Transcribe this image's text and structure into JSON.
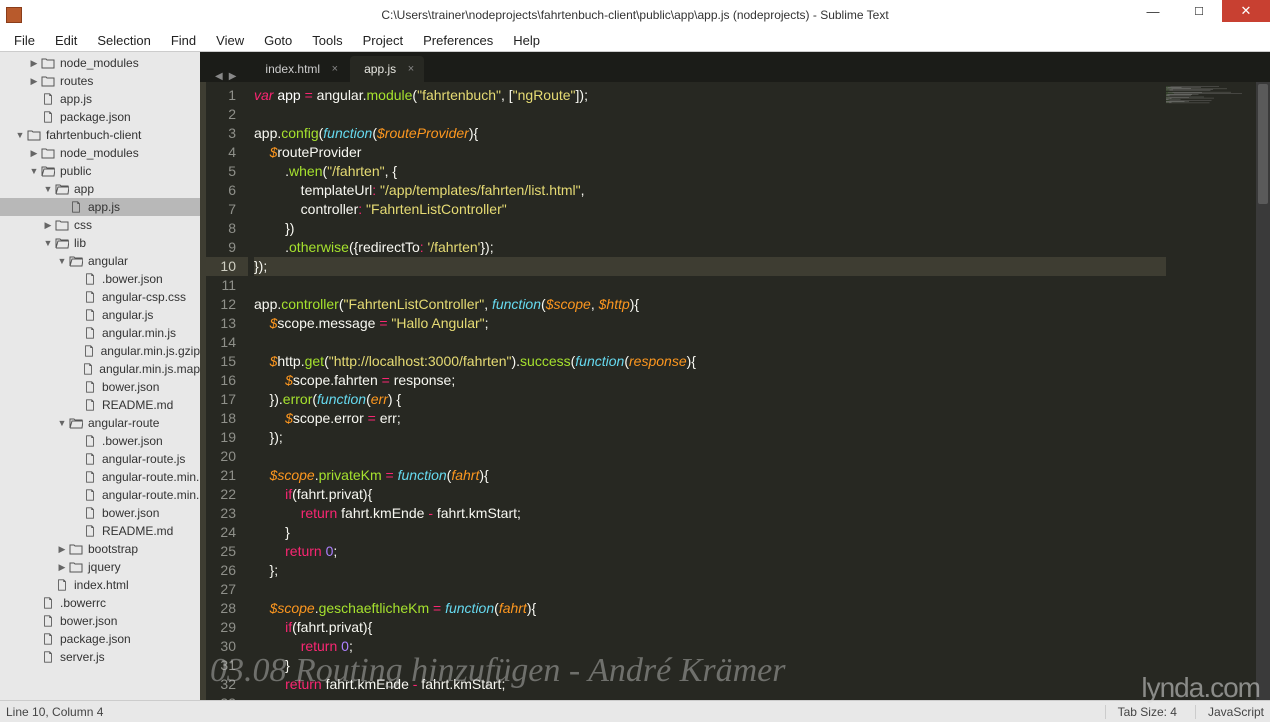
{
  "window": {
    "title": "C:\\Users\\trainer\\nodeprojects\\fahrtenbuch-client\\public\\app\\app.js (nodeprojects) - Sublime Text"
  },
  "menu": [
    "File",
    "Edit",
    "Selection",
    "Find",
    "View",
    "Goto",
    "Tools",
    "Project",
    "Preferences",
    "Help"
  ],
  "sidebar": [
    {
      "d": 2,
      "t": "folder",
      "a": "r",
      "label": "node_modules"
    },
    {
      "d": 2,
      "t": "folder",
      "a": "r",
      "label": "routes"
    },
    {
      "d": 2,
      "t": "file",
      "label": "app.js"
    },
    {
      "d": 2,
      "t": "file",
      "label": "package.json"
    },
    {
      "d": 1,
      "t": "folder",
      "a": "d",
      "label": "fahrtenbuch-client"
    },
    {
      "d": 2,
      "t": "folder",
      "a": "r",
      "label": "node_modules"
    },
    {
      "d": 2,
      "t": "folder-open",
      "a": "d",
      "label": "public"
    },
    {
      "d": 3,
      "t": "folder-open",
      "a": "d",
      "label": "app"
    },
    {
      "d": 4,
      "t": "file",
      "label": "app.js",
      "selected": true
    },
    {
      "d": 3,
      "t": "folder",
      "a": "r",
      "label": "css"
    },
    {
      "d": 3,
      "t": "folder-open",
      "a": "d",
      "label": "lib"
    },
    {
      "d": 4,
      "t": "folder-open",
      "a": "d",
      "label": "angular"
    },
    {
      "d": 5,
      "t": "file",
      "label": ".bower.json"
    },
    {
      "d": 5,
      "t": "file",
      "label": "angular-csp.css"
    },
    {
      "d": 5,
      "t": "file",
      "label": "angular.js"
    },
    {
      "d": 5,
      "t": "file",
      "label": "angular.min.js"
    },
    {
      "d": 5,
      "t": "file",
      "label": "angular.min.js.gzip"
    },
    {
      "d": 5,
      "t": "file",
      "label": "angular.min.js.map"
    },
    {
      "d": 5,
      "t": "file",
      "label": "bower.json"
    },
    {
      "d": 5,
      "t": "file",
      "label": "README.md"
    },
    {
      "d": 4,
      "t": "folder-open",
      "a": "d",
      "label": "angular-route"
    },
    {
      "d": 5,
      "t": "file",
      "label": ".bower.json"
    },
    {
      "d": 5,
      "t": "file",
      "label": "angular-route.js"
    },
    {
      "d": 5,
      "t": "file",
      "label": "angular-route.min."
    },
    {
      "d": 5,
      "t": "file",
      "label": "angular-route.min."
    },
    {
      "d": 5,
      "t": "file",
      "label": "bower.json"
    },
    {
      "d": 5,
      "t": "file",
      "label": "README.md"
    },
    {
      "d": 4,
      "t": "folder",
      "a": "r",
      "label": "bootstrap"
    },
    {
      "d": 4,
      "t": "folder",
      "a": "r",
      "label": "jquery"
    },
    {
      "d": 3,
      "t": "file",
      "label": "index.html"
    },
    {
      "d": 2,
      "t": "file",
      "label": ".bowerrc"
    },
    {
      "d": 2,
      "t": "file",
      "label": "bower.json"
    },
    {
      "d": 2,
      "t": "file",
      "label": "package.json"
    },
    {
      "d": 2,
      "t": "file",
      "label": "server.js"
    }
  ],
  "tabs": [
    {
      "label": "index.html",
      "active": false
    },
    {
      "label": "app.js",
      "active": true
    }
  ],
  "code_lines": [
    "<span class='kw'>var</span> <span class='var'>app</span> <span class='op'>=</span> angular.<span class='fn'>module</span>(<span class='str'>\"fahrtenbuch\"</span>, [<span class='str'>\"ngRoute\"</span>]);",
    "",
    "app.<span class='fn'>config</span>(<span class='st'>function</span>(<span class='arg'>$routeProvider</span>){",
    "    <span class='arg'>$</span>routeProvider",
    "        .<span class='fn'>when</span>(<span class='str'>\"/fahrten\"</span>, {",
    "            templateUrl<span class='op'>:</span> <span class='str'>\"/app/templates/fahrten/list.html\"</span>,",
    "            controller<span class='op'>:</span> <span class='str'>\"FahrtenListController\"</span>",
    "        })",
    "        .<span class='fn'>otherwise</span>({redirectTo<span class='op'>:</span> <span class='str'>'/fahrten'</span>});",
    "});",
    "",
    "app.<span class='fn'>controller</span>(<span class='str'>\"FahrtenListController\"</span>, <span class='st'>function</span>(<span class='arg'>$scope</span>, <span class='arg'>$http</span>){",
    "    <span class='arg'>$</span>scope.message <span class='op'>=</span> <span class='str'>\"Hallo Angular\"</span>;",
    "",
    "    <span class='arg'>$</span>http.<span class='fn'>get</span>(<span class='str'>\"http://localhost:3000/fahrten\"</span>).<span class='fn'>success</span>(<span class='st'>function</span>(<span class='arg'>response</span>){",
    "        <span class='arg'>$</span>scope.fahrten <span class='op'>=</span> response;",
    "    }).<span class='fn'>error</span>(<span class='st'>function</span>(<span class='arg'>err</span>) {",
    "        <span class='arg'>$</span>scope.error <span class='op'>=</span> err;",
    "    });",
    "",
    "    <span class='arg'>$scope</span>.<span class='fn'>privateKm</span> <span class='op'>=</span> <span class='st'>function</span>(<span class='arg'>fahrt</span>){",
    "        <span class='kw2'>if</span>(fahrt.privat){",
    "            <span class='kw2'>return</span> fahrt.kmEnde <span class='op'>-</span> fahrt.kmStart;",
    "        }",
    "        <span class='kw2'>return</span> <span class='num'>0</span>;",
    "    };",
    "",
    "    <span class='arg'>$scope</span>.<span class='fn'>geschaeftlicheKm</span> <span class='op'>=</span> <span class='st'>function</span>(<span class='arg'>fahrt</span>){",
    "        <span class='kw2'>if</span>(fahrt.privat){",
    "            <span class='kw2'>return</span> <span class='num'>0</span>;",
    "        }",
    "        <span class='kw2'>return</span> fahrt.kmEnde <span class='op'>-</span> fahrt.kmStart;",
    ""
  ],
  "current_line": 10,
  "status": {
    "left": "Line 10, Column 4",
    "tab_size": "Tab Size: 4",
    "lang": "JavaScript"
  },
  "watermark": "03.08 Routing hinzufügen - André Krämer",
  "watermark2": "lynda.com"
}
